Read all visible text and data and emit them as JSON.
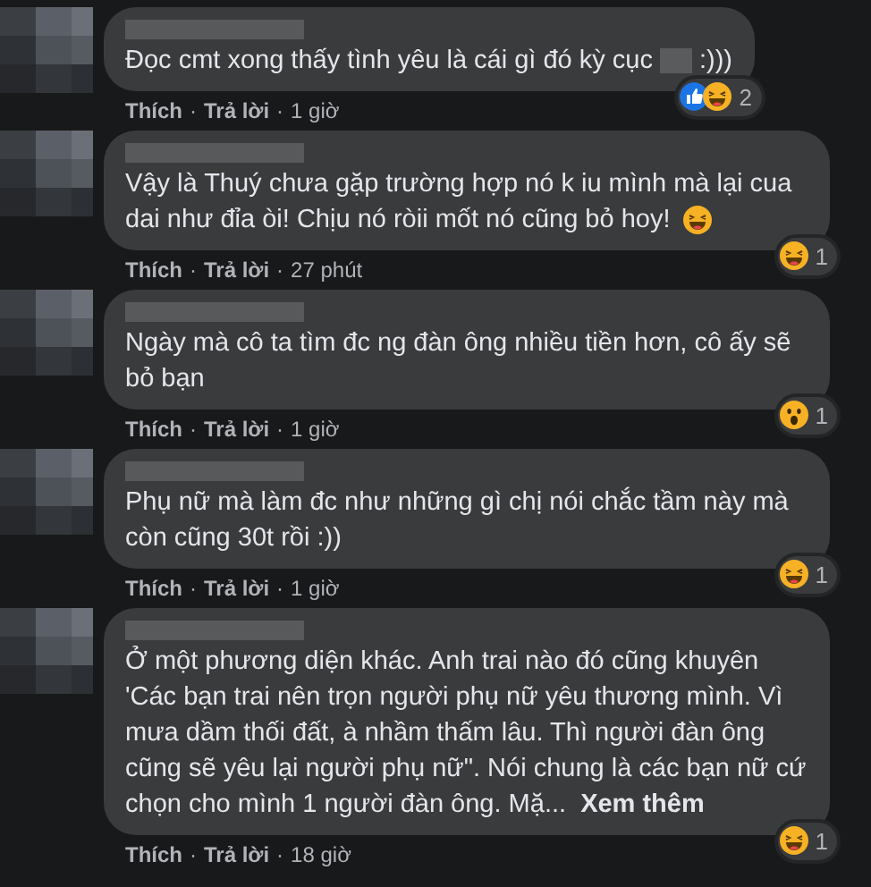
{
  "comments": [
    {
      "text": "Đọc cmt xong thấy tình yêu là cái gì đó kỳ cục",
      "redacted": true,
      "text_after": ":)))",
      "reactions": [
        {
          "kind": "like"
        },
        {
          "kind": "haha"
        }
      ],
      "reaction_count": "2",
      "like": "Thích",
      "separator": "·",
      "reply": "Trả lời",
      "time": "1 giờ"
    },
    {
      "text": "Vậy là Thuý chưa gặp trường hợp nó k iu mình mà lại cua dai như đỉa òi! Chịu nó ròii mốt nó cũng bỏ hoy!",
      "trailing_reaction": {
        "kind": "haha"
      },
      "reactions": [
        {
          "kind": "haha"
        }
      ],
      "reaction_count": "1",
      "like": "Thích",
      "separator": "·",
      "reply": "Trả lời",
      "time": "27 phút"
    },
    {
      "text": "Ngày mà cô ta tìm đc ng đàn ông nhiều tiền hơn, cô ấy sẽ bỏ bạn",
      "reactions": [
        {
          "kind": "wow"
        }
      ],
      "reaction_count": "1",
      "like": "Thích",
      "separator": "·",
      "reply": "Trả lời",
      "time": "1 giờ"
    },
    {
      "text": "Phụ nữ mà làm đc như những gì chị nói chắc tầm này mà còn cũng 30t rồi :))",
      "reactions": [
        {
          "kind": "haha"
        }
      ],
      "reaction_count": "1",
      "like": "Thích",
      "separator": "·",
      "reply": "Trả lời",
      "time": "1 giờ"
    },
    {
      "text": "Ở một phương diện khác. Anh trai nào đó cũng khuyên 'Các bạn trai nên trọn người phụ nữ yêu thương mình. Vì mưa dầm thối đất, à nhầm thấm lâu. Thì người đàn ông cũng sẽ yêu lại người phụ nữ\". Nói chung là các bạn nữ cứ chọn cho mình 1 người đàn ông. Mặ...",
      "see_more": "Xem thêm",
      "reactions": [
        {
          "kind": "haha"
        }
      ],
      "reaction_count": "1",
      "like": "Thích",
      "separator": "·",
      "reply": "Trả lời",
      "time": "18 giờ"
    }
  ]
}
